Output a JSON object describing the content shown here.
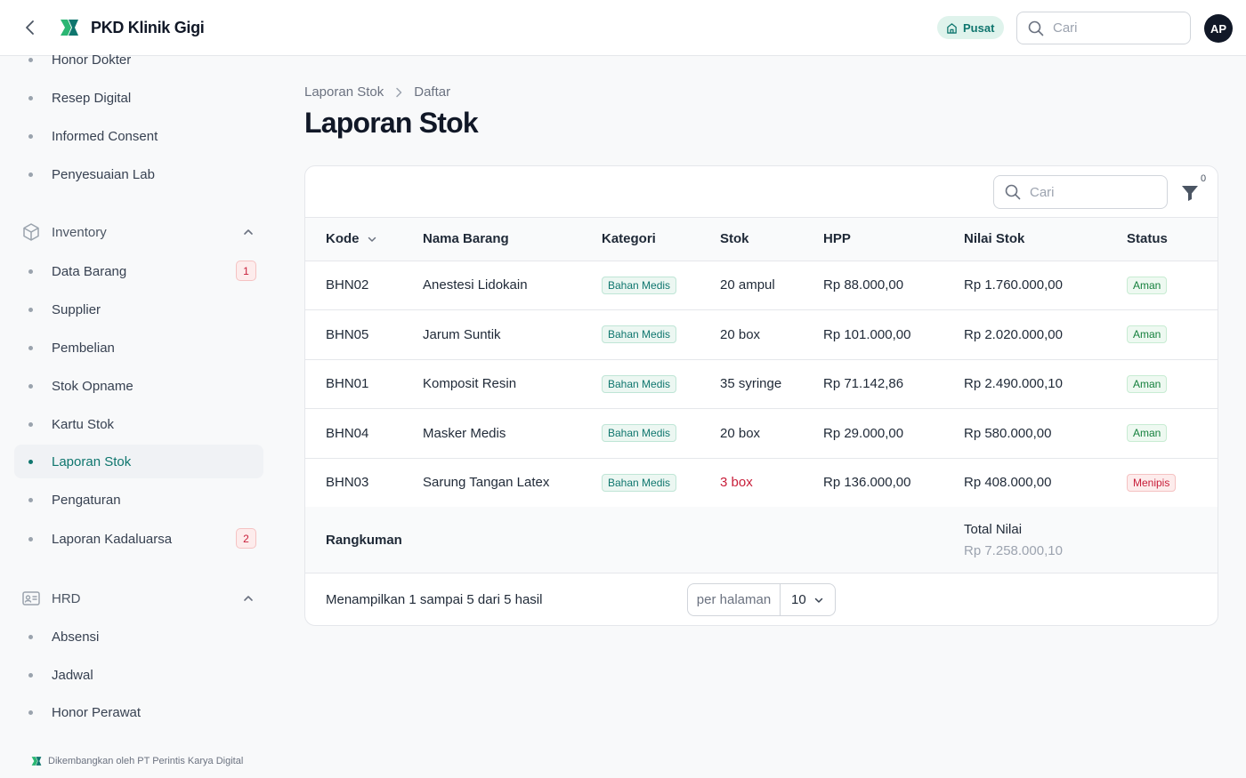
{
  "app": {
    "name": "PKD Klinik Gigi",
    "branch": "Pusat",
    "avatar_initials": "AP"
  },
  "search": {
    "placeholder": "Cari"
  },
  "sidebar": {
    "items_top": [
      {
        "label": "Honor Dokter"
      },
      {
        "label": "Resep Digital"
      },
      {
        "label": "Informed Consent"
      },
      {
        "label": "Penyesuaian Lab"
      }
    ],
    "groups": [
      {
        "label": "Inventory",
        "items": [
          {
            "label": "Data Barang",
            "count": "1"
          },
          {
            "label": "Supplier"
          },
          {
            "label": "Pembelian"
          },
          {
            "label": "Stok Opname"
          },
          {
            "label": "Kartu Stok"
          },
          {
            "label": "Laporan Stok",
            "active": true
          },
          {
            "label": "Pengaturan"
          },
          {
            "label": "Laporan Kadaluarsa",
            "count": "2"
          }
        ]
      },
      {
        "label": "HRD",
        "items": [
          {
            "label": "Absensi"
          },
          {
            "label": "Jadwal"
          },
          {
            "label": "Honor Perawat"
          }
        ]
      }
    ],
    "footer": "Dikembangkan oleh PT Perintis Karya Digital"
  },
  "breadcrumb": {
    "parent": "Laporan Stok",
    "current": "Daftar"
  },
  "page_title": "Laporan Stok",
  "table": {
    "search_placeholder": "Cari",
    "filter_count": "0",
    "columns": [
      "Kode",
      "Nama Barang",
      "Kategori",
      "Stok",
      "HPP",
      "Nilai Stok",
      "Status"
    ],
    "rows": [
      {
        "kode": "BHN02",
        "nama": "Anestesi Lidokain",
        "kategori": "Bahan Medis",
        "stok": "20 ampul",
        "hpp": "Rp 88.000,00",
        "nilai": "Rp 1.760.000,00",
        "status": "Aman"
      },
      {
        "kode": "BHN05",
        "nama": "Jarum Suntik",
        "kategori": "Bahan Medis",
        "stok": "20 box",
        "hpp": "Rp 101.000,00",
        "nilai": "Rp 2.020.000,00",
        "status": "Aman"
      },
      {
        "kode": "BHN01",
        "nama": "Komposit Resin",
        "kategori": "Bahan Medis",
        "stok": "35 syringe",
        "hpp": "Rp 71.142,86",
        "nilai": "Rp 2.490.000,10",
        "status": "Aman"
      },
      {
        "kode": "BHN04",
        "nama": "Masker Medis",
        "kategori": "Bahan Medis",
        "stok": "20 box",
        "hpp": "Rp 29.000,00",
        "nilai": "Rp 580.000,00",
        "status": "Aman"
      },
      {
        "kode": "BHN03",
        "nama": "Sarung Tangan Latex",
        "kategori": "Bahan Medis",
        "stok": "3 box",
        "hpp": "Rp 136.000,00",
        "nilai": "Rp 408.000,00",
        "status": "Menipis"
      }
    ],
    "summary_label": "Rangkuman",
    "total_label": "Total Nilai",
    "total_value": "Rp 7.258.000,10"
  },
  "pagination": {
    "text": "Menampilkan 1 sampai 5 dari 5 hasil",
    "per_page_label": "per halaman",
    "per_page_value": "10"
  },
  "colors": {
    "accent": "#0f766e",
    "danger": "#c81e3a",
    "success": "#15803d"
  }
}
